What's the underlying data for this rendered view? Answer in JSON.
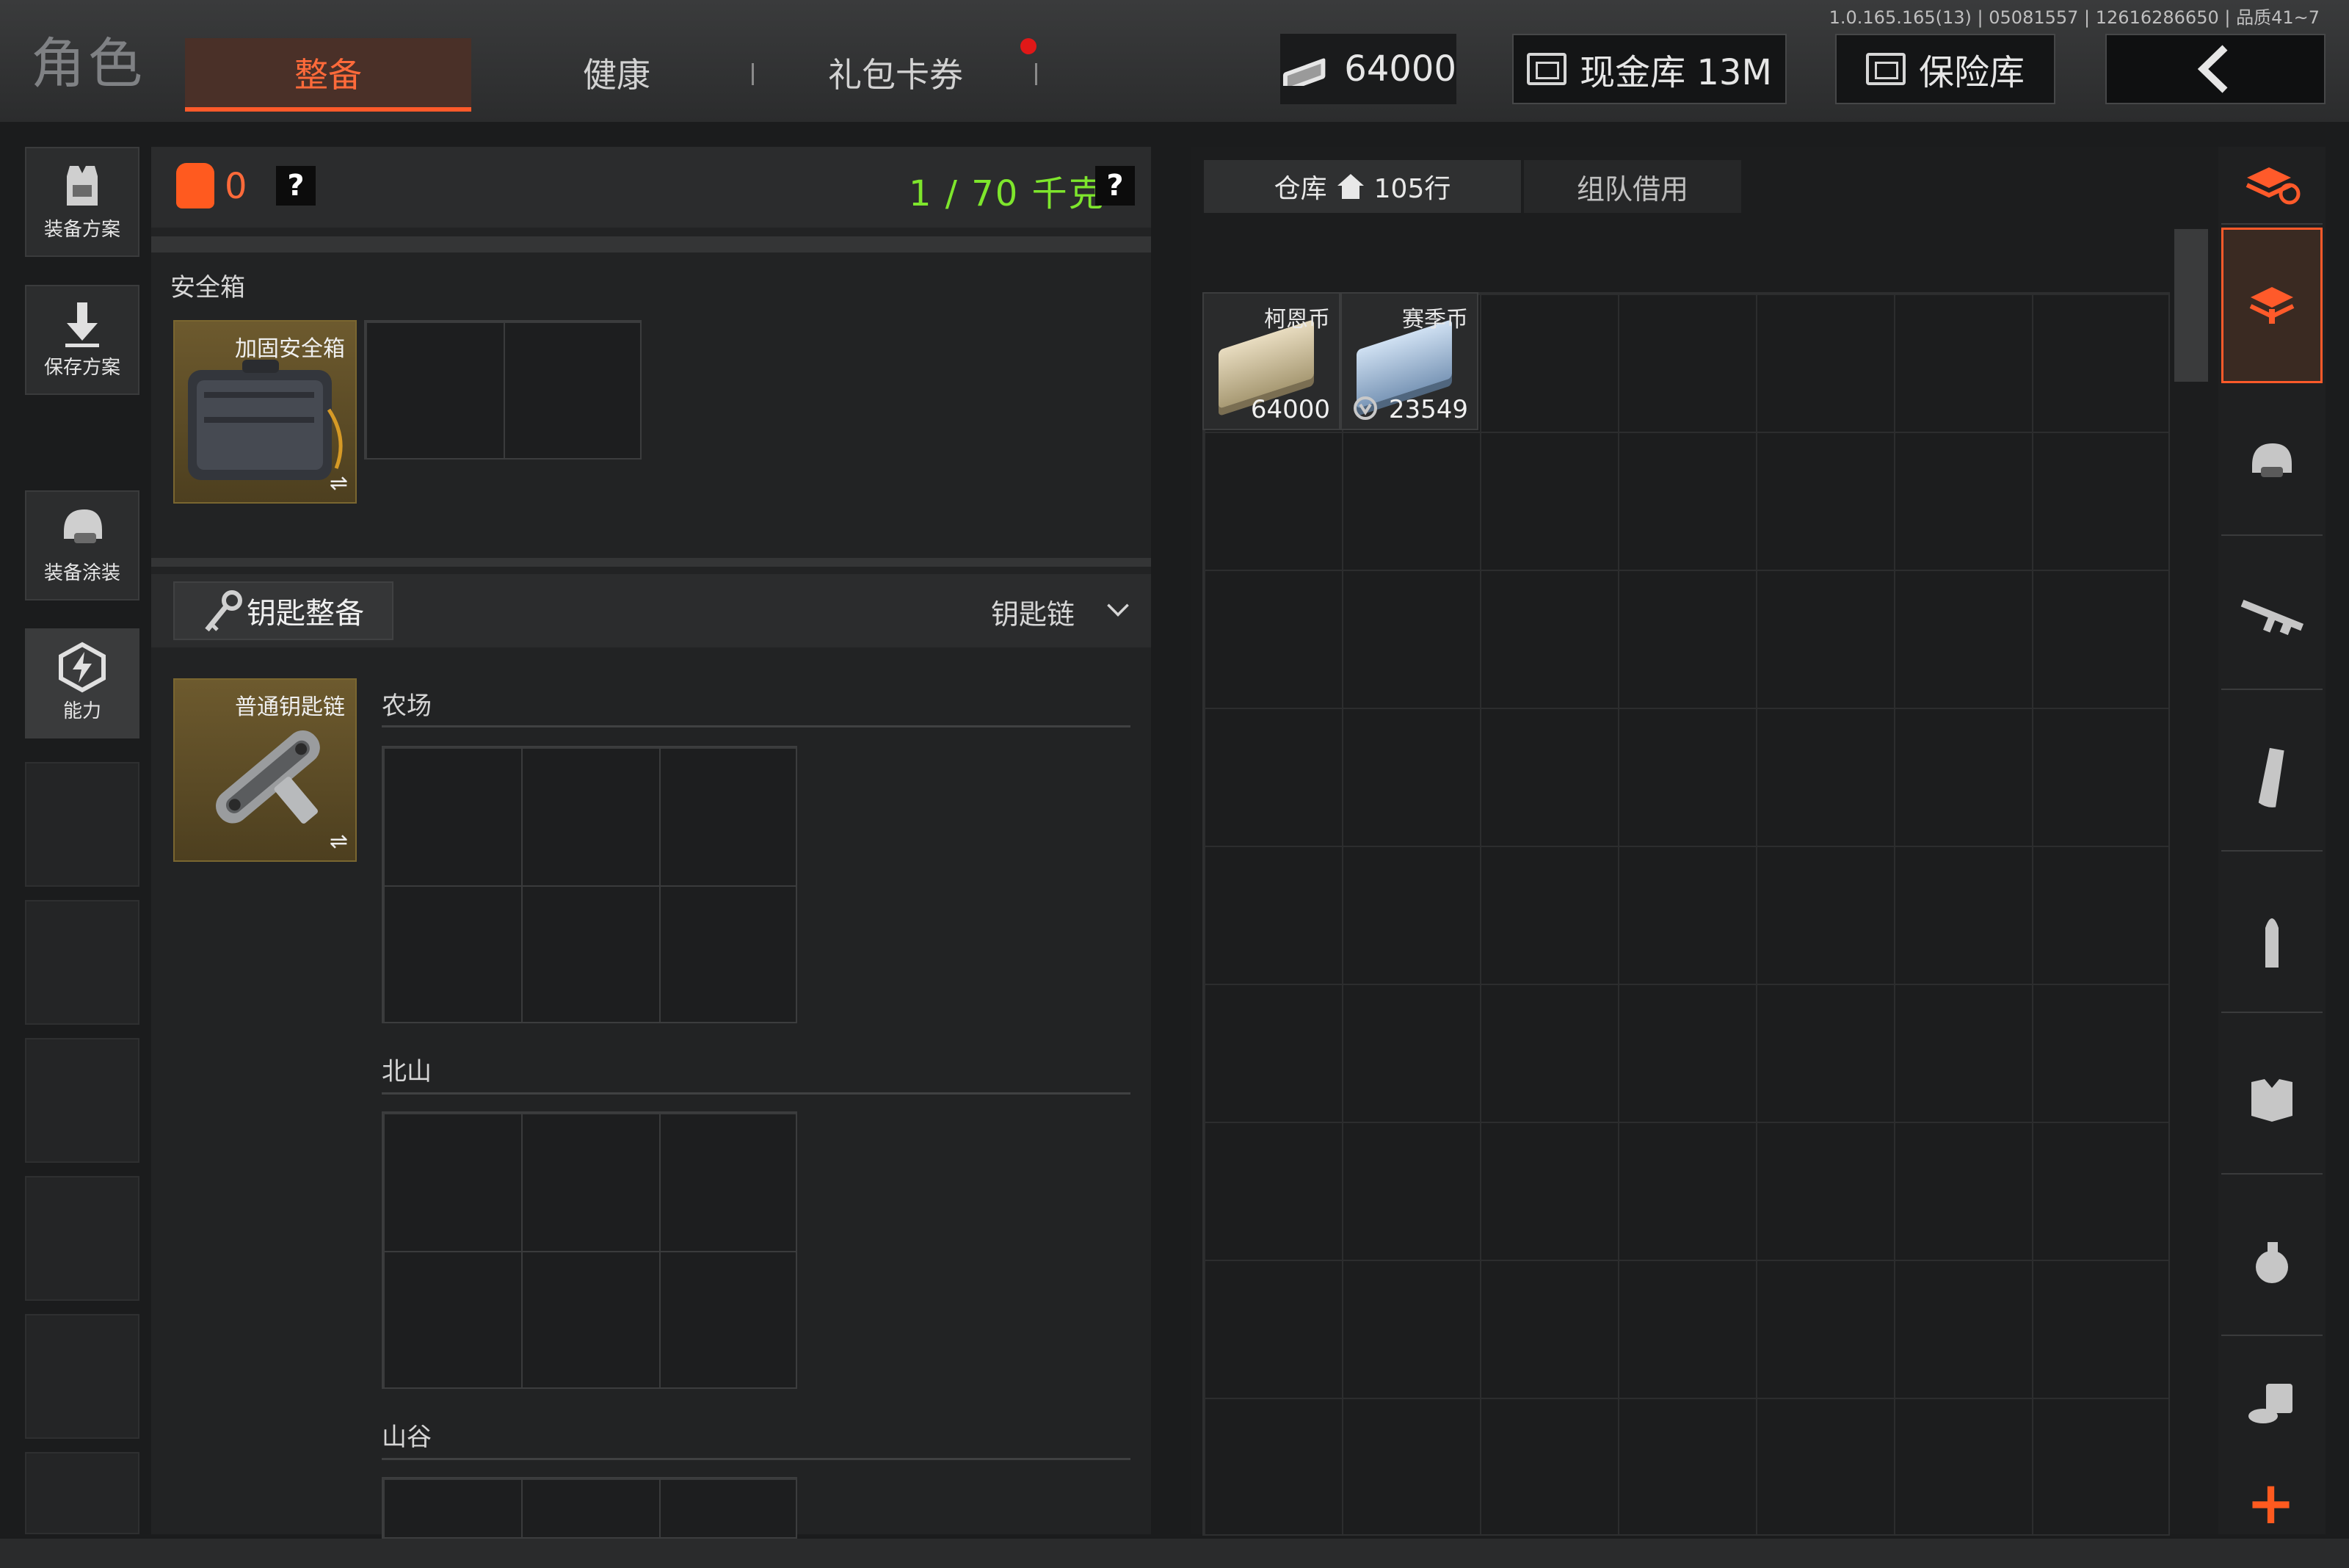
{
  "version": "1.0.165.165(13) | 05081557 | 12616286650 | 品质41~7",
  "header": {
    "title": "角色",
    "tabs": [
      {
        "label": "整备",
        "active": true
      },
      {
        "label": "健康",
        "active": false
      },
      {
        "label": "礼包卡券",
        "active": false
      }
    ],
    "money": "64000",
    "cash_vault_label": "现金库 13M",
    "safe_vault_label": "保险库"
  },
  "sidebar": {
    "items": [
      {
        "label": "装备方案",
        "icon": "vest-icon"
      },
      {
        "label": "保存方案",
        "icon": "download-icon"
      },
      {
        "label": "装备涂装",
        "icon": "helmet-icon"
      },
      {
        "label": "能力",
        "icon": "lightning-icon"
      }
    ]
  },
  "loadout": {
    "bag_count": "0",
    "weight": "1 / 70 千克",
    "help": "?",
    "safe_box": {
      "title": "安全箱",
      "item_name": "加固安全箱",
      "swap": "⇌"
    },
    "keys": {
      "button_label": "钥匙整备",
      "keychain_select": "钥匙链",
      "item_name": "普通钥匙链",
      "swap": "⇌",
      "regions": [
        "农场",
        "北山",
        "山谷"
      ]
    }
  },
  "warehouse": {
    "tab_label": "仓库",
    "rows": "105行",
    "team_tab_label": "组队借用",
    "items": [
      {
        "name": "柯恩币",
        "qty": "64000"
      },
      {
        "name": "赛季币",
        "qty": "23549"
      }
    ]
  },
  "rail": {
    "icons": [
      "stack-refresh-icon",
      "stack-download-icon",
      "helmet-icon",
      "rifle-icon",
      "magazine-icon",
      "bullet-icon",
      "vest-icon",
      "grenade-icon",
      "coins-icon"
    ],
    "plus": "+"
  },
  "colors": {
    "accent": "#ff5a2a",
    "weight_green": "#7ee62c",
    "item_gold": "#6d5a2e"
  }
}
